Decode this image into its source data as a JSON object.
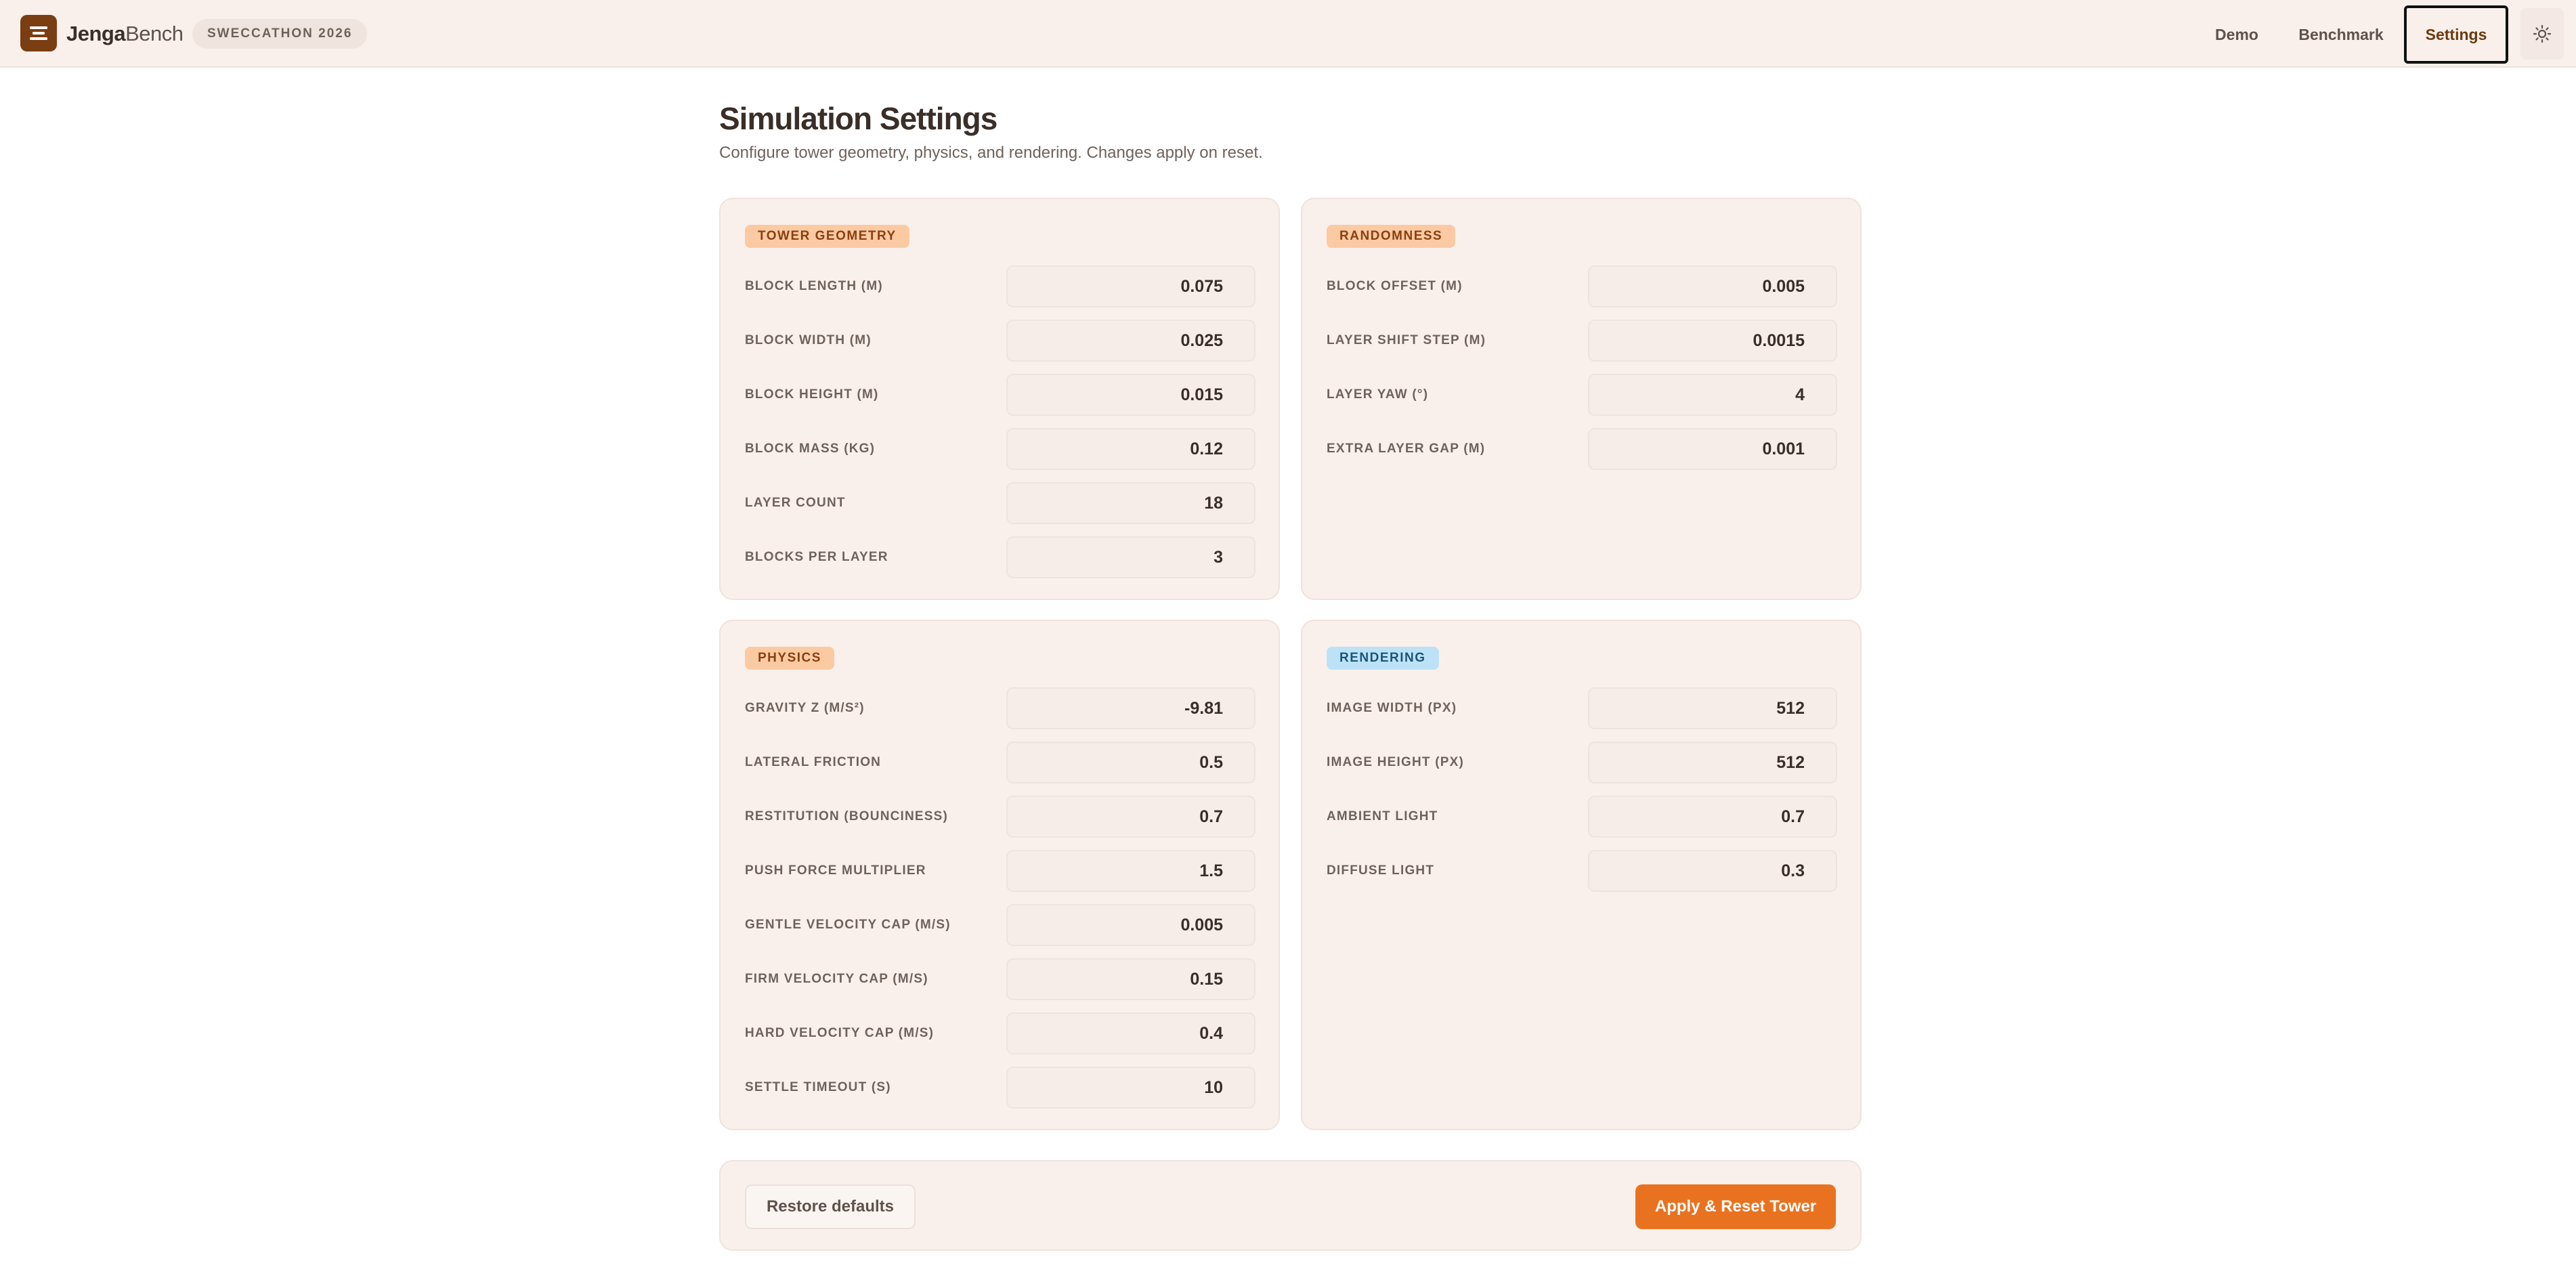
{
  "header": {
    "brand_bold": "Jenga",
    "brand_light": "Bench",
    "event_badge": "SWECCATHON 2026",
    "nav": {
      "demo": "Demo",
      "benchmark": "Benchmark",
      "settings": "Settings"
    },
    "theme_icon": "sun-icon"
  },
  "page": {
    "title": "Simulation Settings",
    "subtitle": "Configure tower geometry, physics, and rendering. Changes apply on reset."
  },
  "sections": {
    "geometry": {
      "badge": "TOWER GEOMETRY",
      "fields": [
        {
          "label": "BLOCK LENGTH (M)",
          "value": "0.075"
        },
        {
          "label": "BLOCK WIDTH (M)",
          "value": "0.025"
        },
        {
          "label": "BLOCK HEIGHT (M)",
          "value": "0.015"
        },
        {
          "label": "BLOCK MASS (KG)",
          "value": "0.12"
        },
        {
          "label": "LAYER COUNT",
          "value": "18"
        },
        {
          "label": "BLOCKS PER LAYER",
          "value": "3"
        }
      ]
    },
    "randomness": {
      "badge": "RANDOMNESS",
      "fields": [
        {
          "label": "BLOCK OFFSET (M)",
          "value": "0.005"
        },
        {
          "label": "LAYER SHIFT STEP (M)",
          "value": "0.0015"
        },
        {
          "label": "LAYER YAW (°)",
          "value": "4"
        },
        {
          "label": "EXTRA LAYER GAP (M)",
          "value": "0.001"
        }
      ]
    },
    "physics": {
      "badge": "PHYSICS",
      "fields": [
        {
          "label": "GRAVITY Z (M/S²)",
          "value": "-9.81"
        },
        {
          "label": "LATERAL FRICTION",
          "value": "0.5"
        },
        {
          "label": "RESTITUTION (BOUNCINESS)",
          "value": "0.7"
        },
        {
          "label": "PUSH FORCE MULTIPLIER",
          "value": "1.5"
        },
        {
          "label": "GENTLE VELOCITY CAP (M/S)",
          "value": "0.005"
        },
        {
          "label": "FIRM VELOCITY CAP (M/S)",
          "value": "0.15"
        },
        {
          "label": "HARD VELOCITY CAP (M/S)",
          "value": "0.4"
        },
        {
          "label": "SETTLE TIMEOUT (S)",
          "value": "10"
        }
      ]
    },
    "rendering": {
      "badge": "RENDERING",
      "fields": [
        {
          "label": "IMAGE WIDTH (PX)",
          "value": "512"
        },
        {
          "label": "IMAGE HEIGHT (PX)",
          "value": "512"
        },
        {
          "label": "AMBIENT LIGHT",
          "value": "0.7"
        },
        {
          "label": "DIFFUSE LIGHT",
          "value": "0.3"
        }
      ]
    }
  },
  "footer": {
    "restore_label": "Restore defaults",
    "apply_label": "Apply & Reset Tower"
  },
  "colors": {
    "accent": "#e97220",
    "brand_dark": "#7a3e12",
    "card_bg": "#f9f0ec",
    "badge_orange": "#fbcaa3",
    "badge_blue": "#bde2f8"
  }
}
